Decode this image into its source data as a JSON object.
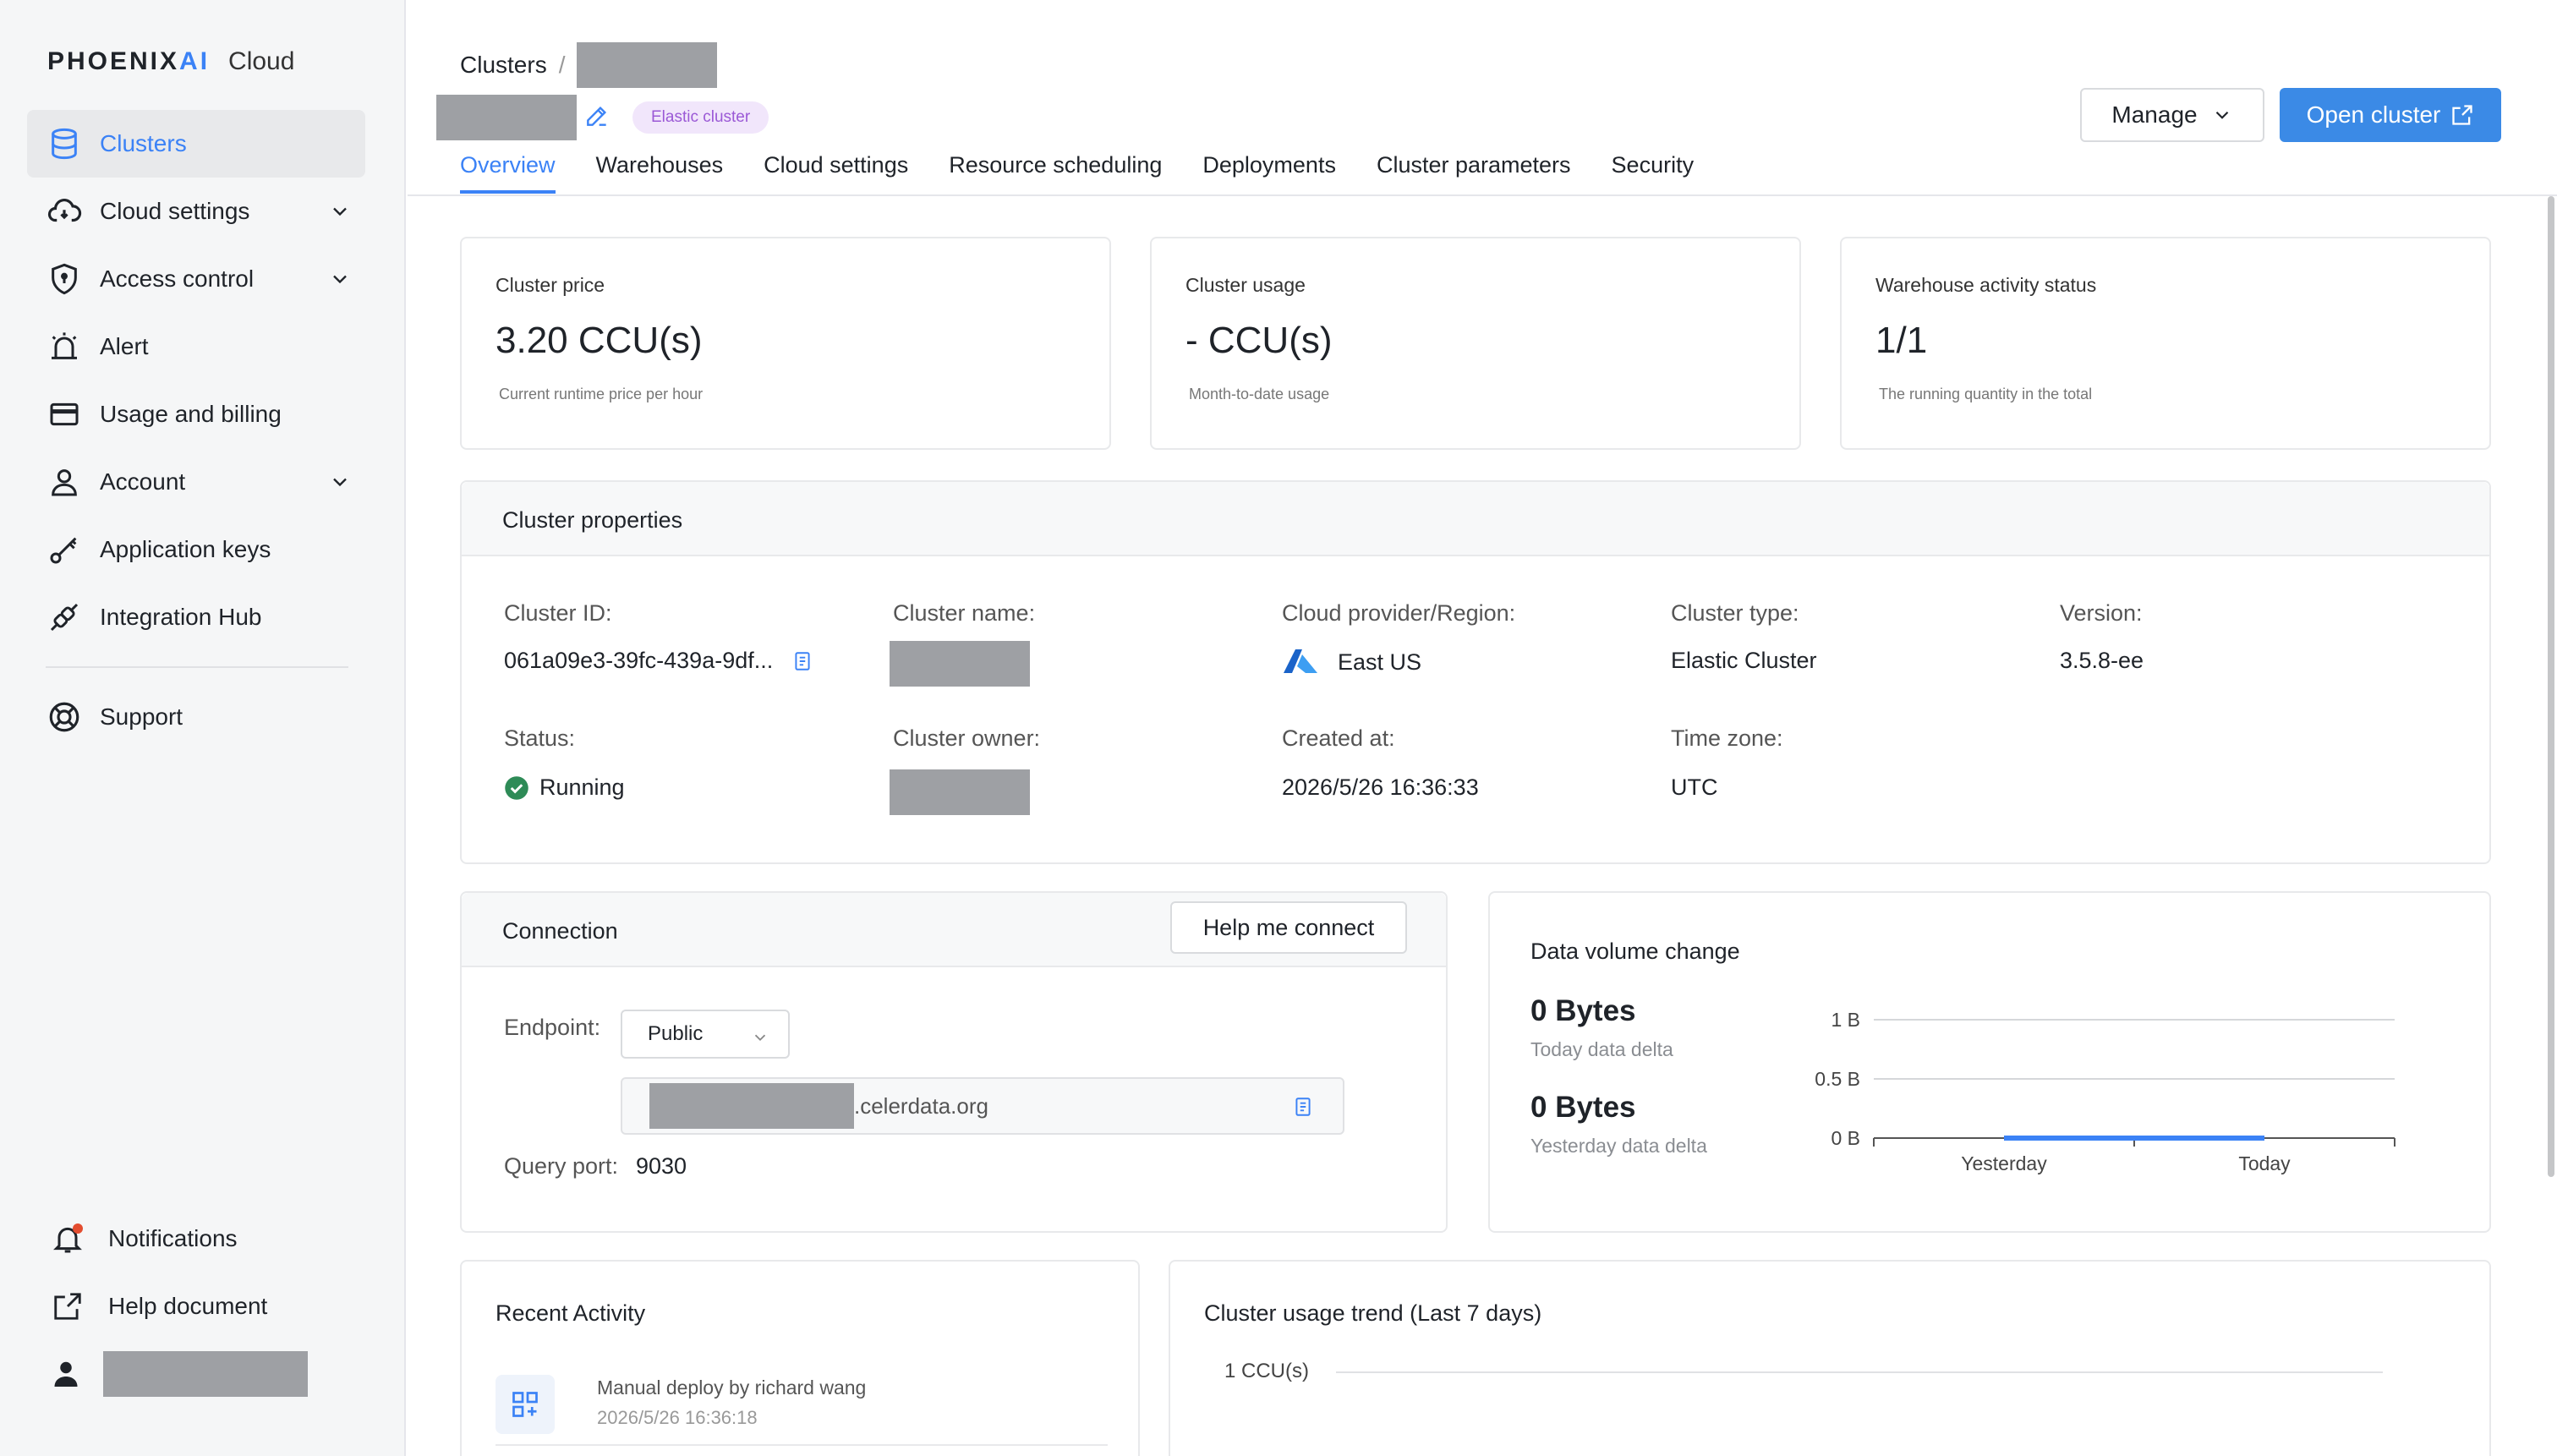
{
  "sidebar": {
    "logo_main": "PHOENIX",
    "logo_ai": "AI",
    "logo_cloud": "Cloud",
    "items": [
      {
        "label": "Clusters",
        "icon": "database-icon"
      },
      {
        "label": "Cloud settings",
        "icon": "cloud-sync-icon"
      },
      {
        "label": "Access control",
        "icon": "shield-icon"
      },
      {
        "label": "Alert",
        "icon": "alarm-icon"
      },
      {
        "label": "Usage and billing",
        "icon": "credit-card-icon"
      },
      {
        "label": "Account",
        "icon": "user-icon"
      },
      {
        "label": "Application keys",
        "icon": "key-icon"
      },
      {
        "label": "Integration Hub",
        "icon": "plug-icon"
      },
      {
        "label": "Support",
        "icon": "lifebuoy-icon"
      }
    ],
    "bottom": {
      "notifications": "Notifications",
      "help": "Help document"
    }
  },
  "header": {
    "breadcrumb_root": "Clusters",
    "breadcrumb_sep": "/",
    "badge": "Elastic cluster",
    "manage": "Manage",
    "open_cluster": "Open cluster",
    "tabs": [
      "Overview",
      "Warehouses",
      "Cloud settings",
      "Resource scheduling",
      "Deployments",
      "Cluster parameters",
      "Security"
    ]
  },
  "stats": [
    {
      "label": "Cluster price",
      "value": "3.20 CCU(s)",
      "sub": "Current runtime price per hour"
    },
    {
      "label": "Cluster usage",
      "value": "- CCU(s)",
      "sub": "Month-to-date usage"
    },
    {
      "label": "Warehouse activity status",
      "value": "1/1",
      "sub": "The running quantity in the total"
    }
  ],
  "properties": {
    "title": "Cluster properties",
    "cluster_id_label": "Cluster ID:",
    "cluster_id": "061a09e3-39fc-439a-9df...",
    "cluster_name_label": "Cluster name:",
    "provider_label": "Cloud provider/Region:",
    "provider_value": "East US",
    "type_label": "Cluster type:",
    "type_value": "Elastic Cluster",
    "version_label": "Version:",
    "version_value": "3.5.8-ee",
    "status_label": "Status:",
    "status_value": "Running",
    "owner_label": "Cluster owner:",
    "created_label": "Created at:",
    "created_value": "2026/5/26 16:36:33",
    "tz_label": "Time zone:",
    "tz_value": "UTC"
  },
  "connection": {
    "title": "Connection",
    "help_button": "Help me connect",
    "endpoint_label": "Endpoint:",
    "endpoint_select": "Public",
    "endpoint_suffix": ".celerdata.org",
    "query_port_label": "Query port:",
    "query_port": "9030"
  },
  "data_volume": {
    "title": "Data volume change",
    "today_value": "0 Bytes",
    "today_label": "Today data delta",
    "yesterday_value": "0 Bytes",
    "yesterday_label": "Yesterday data delta"
  },
  "chart_data": [
    {
      "type": "line",
      "title": "",
      "categories": [
        "Yesterday",
        "Today"
      ],
      "series": [
        {
          "values": [
            0,
            0
          ]
        }
      ],
      "yticks": [
        "0 B",
        "0.5 B",
        "1 B"
      ],
      "ylim": [
        0,
        1
      ],
      "grid": true,
      "color": "#3b82f6"
    },
    {
      "type": "line",
      "title": "Cluster usage trend (Last 7 days)",
      "yticks": [
        "1 CCU(s)"
      ],
      "series": [],
      "grid": true
    }
  ],
  "activity": {
    "title": "Recent Activity",
    "items": [
      {
        "text": "Manual deploy by richard wang",
        "time": "2026/5/26 16:36:18"
      }
    ]
  },
  "colors": {
    "accent": "#3b82f6",
    "success": "#2e8b57",
    "badge_bg": "#f1e6fb"
  }
}
